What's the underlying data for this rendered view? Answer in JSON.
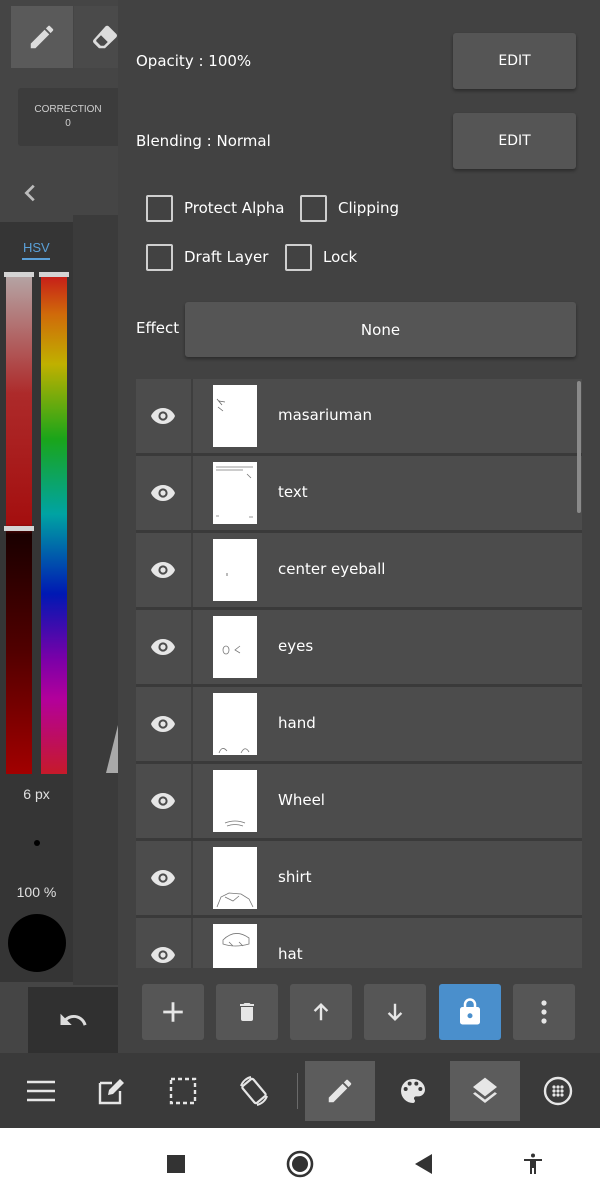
{
  "left_tools": {
    "correction_label": "CORRECTION",
    "correction_value": "0",
    "color_mode": "HSV",
    "brush_size": "6 px",
    "brush_opacity": "100 %",
    "current_color": "#000000",
    "icons": [
      "pencil-icon",
      "eraser-icon",
      "chevron-left-icon",
      "undo-icon"
    ]
  },
  "layer_properties": {
    "opacity": "Opacity : 100%",
    "blending": "Blending : Normal",
    "edit_label": "EDIT",
    "checkboxes": [
      {
        "label": "Protect Alpha",
        "checked": false
      },
      {
        "label": "Clipping",
        "checked": false
      },
      {
        "label": "Draft Layer",
        "checked": false
      },
      {
        "label": "Lock",
        "checked": false
      }
    ],
    "effect_label": "Effect",
    "effect_value": "None"
  },
  "layers": [
    {
      "name": "masariuman",
      "visible": true
    },
    {
      "name": "text",
      "visible": true
    },
    {
      "name": "center eyeball",
      "visible": true
    },
    {
      "name": "eyes",
      "visible": true
    },
    {
      "name": "hand",
      "visible": true
    },
    {
      "name": "Wheel",
      "visible": true
    },
    {
      "name": "shirt",
      "visible": true
    },
    {
      "name": "hat",
      "visible": true
    }
  ],
  "layer_actions": [
    "plus-icon",
    "trash-icon",
    "arrow-up-icon",
    "arrow-down-icon",
    "lock-icon",
    "more-vertical-icon"
  ],
  "toolbar": [
    "menu-icon",
    "edit-icon",
    "selection-icon",
    "rotate-icon",
    "pen-icon",
    "palette-icon",
    "layers-icon",
    "materials-icon"
  ],
  "colors": {
    "accent": "#4a8fcc",
    "panel": "#424242",
    "row": "#4c4c4c"
  }
}
